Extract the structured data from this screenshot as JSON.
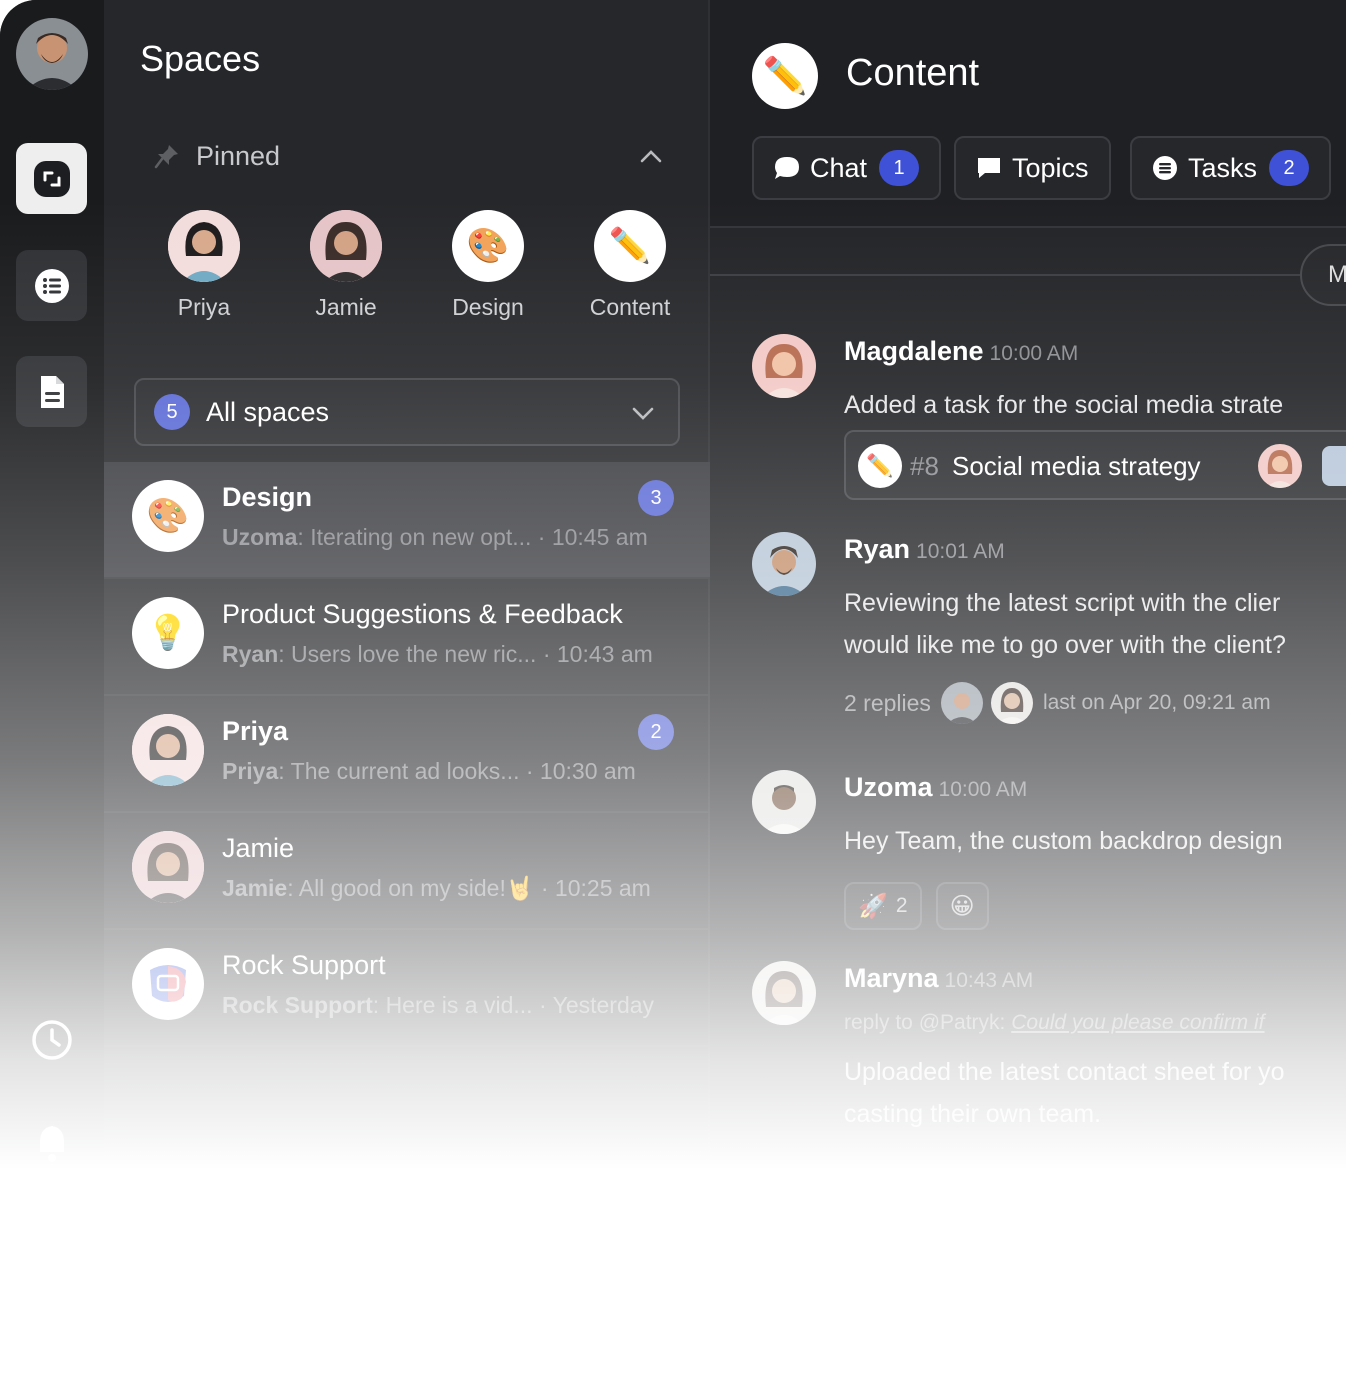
{
  "rail": {
    "items": [
      {
        "icon": "spaces-icon",
        "active": true
      },
      {
        "icon": "list-icon",
        "active": false
      },
      {
        "icon": "document-icon",
        "active": false
      }
    ],
    "bottom_icons": [
      "history-icon",
      "bell-icon"
    ]
  },
  "spaces": {
    "title": "Spaces",
    "pinned_label": "Pinned",
    "pinned": [
      {
        "label": "Priya"
      },
      {
        "label": "Jamie"
      },
      {
        "label": "Design",
        "emoji": "🎨"
      },
      {
        "label": "Content",
        "emoji": "✏️"
      }
    ],
    "filter": {
      "count": "5",
      "label": "All spaces"
    },
    "list": [
      {
        "name": "Design",
        "emoji": "🎨",
        "author": "Uzoma",
        "preview": "Iterating on new opt...",
        "time": "· 10:45 am",
        "badge": "3"
      },
      {
        "name": "Product Suggestions & Feedback",
        "emoji": "💡",
        "author": "Ryan",
        "preview": "Users love the new ric...",
        "time": "· 10:43 am",
        "badge": ""
      },
      {
        "name": "Priya",
        "author": "Priya",
        "preview": "The current ad looks...",
        "time": "· 10:30 am",
        "badge": "2"
      },
      {
        "name": "Jamie",
        "author": "Jamie",
        "preview": "All good on my side!🤘",
        "time": "· 10:25 am",
        "badge": ""
      },
      {
        "name": "Rock Support",
        "author": "Rock Support",
        "preview": "Here is a vid...",
        "time": "· Yesterday",
        "badge": ""
      }
    ]
  },
  "channel": {
    "title": "Content",
    "emoji": "✏️",
    "tabs": [
      {
        "label": "Chat",
        "badge": "1"
      },
      {
        "label": "Topics",
        "badge": ""
      },
      {
        "label": "Tasks",
        "badge": "2"
      }
    ],
    "date_pill": "M"
  },
  "messages": [
    {
      "name": "Magdalene",
      "time": "10:00 AM",
      "text": "Added a task for the social media strate",
      "task": {
        "number": "#8",
        "title": "Social media strategy",
        "emoji": "✏️"
      }
    },
    {
      "name": "Ryan",
      "time": "10:01 AM",
      "lines": [
        "Reviewing the latest script with the clier",
        "would like me to go over with the client?"
      ],
      "replies": {
        "count": "2 replies",
        "last": "last on Apr 20, 09:21 am"
      }
    },
    {
      "name": "Uzoma",
      "time": "10:00 AM",
      "text": "Hey Team, the custom backdrop design",
      "reactions": [
        {
          "emoji": "🚀",
          "count": "2"
        },
        {
          "emoji": "😀",
          "count": ""
        }
      ]
    },
    {
      "name": "Maryna",
      "time": "10:43 AM",
      "reply_prefix": "reply to @Patryk:",
      "reply_quote": "Could you please confirm if",
      "lines": [
        "Uploaded the latest contact sheet for yo",
        "casting their own team."
      ]
    }
  ]
}
